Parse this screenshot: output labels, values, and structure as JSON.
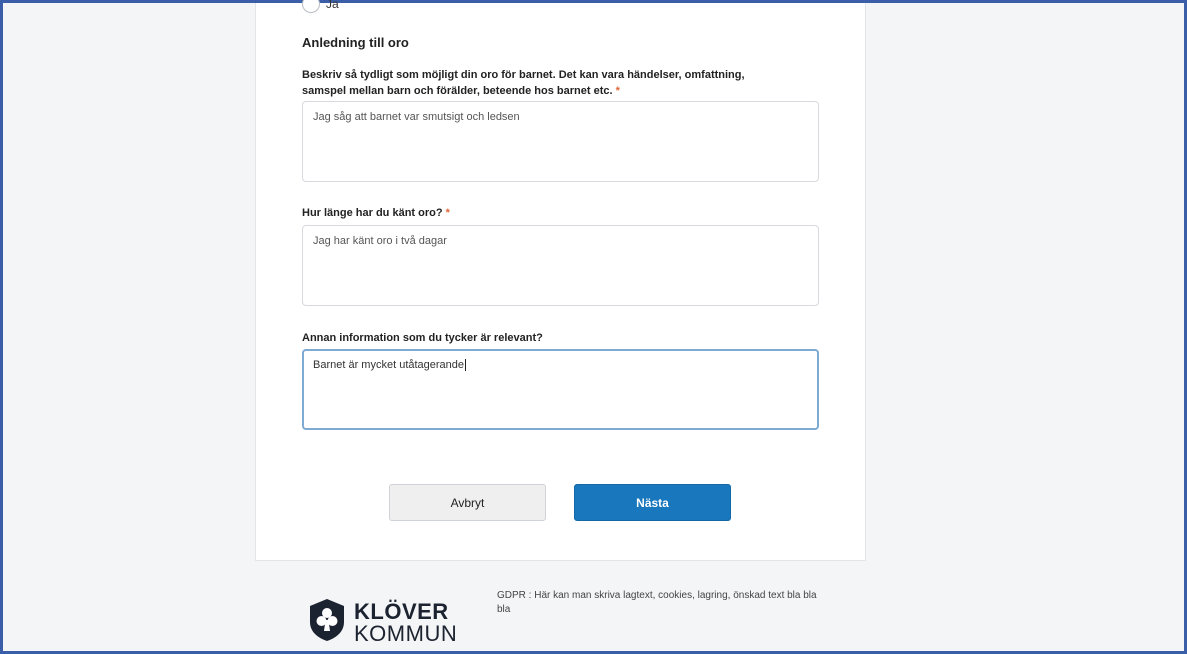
{
  "form": {
    "radio_option_label": "Ja",
    "section_title": "Anledning till oro",
    "fields": [
      {
        "label_line1": "Beskriv så tydligt som möjligt din oro för barnet. Det kan vara händelser, omfattning,",
        "label_line2": "samspel mellan barn och förälder, beteende hos barnet etc.",
        "required_mark": "*",
        "value": "Jag såg att barnet var smutsigt och ledsen"
      },
      {
        "label": "Hur länge har du känt oro?",
        "required_mark": "*",
        "value": "Jag har känt oro i två dagar"
      },
      {
        "label": "Annan information som du tycker är relevant?",
        "value": "Barnet är mycket utåtagerande"
      }
    ],
    "cancel_label": "Avbryt",
    "next_label": "Nästa"
  },
  "footer": {
    "logo_line1": "KLÖVER",
    "logo_line2": "KOMMUN",
    "logo_icon": "club-shield-icon",
    "gdpr_text": "GDPR : Här kan man skriva lagtext, cookies, lagring, önskad text bla bla bla"
  },
  "colors": {
    "primary": "#1877bd",
    "required": "#e0673a",
    "frame_border": "#3b5ea8",
    "focus_border": "#7eaad4"
  }
}
